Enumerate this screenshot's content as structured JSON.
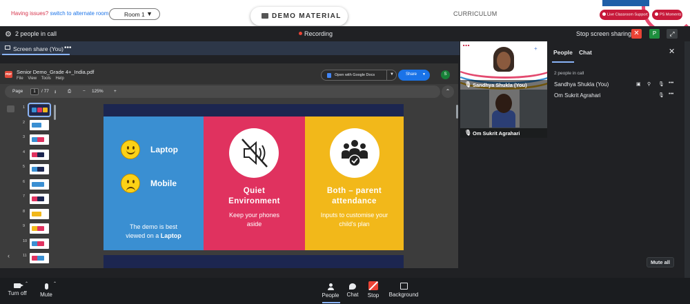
{
  "topbar": {
    "issues_text": "Having issues?",
    "alt_room_link": "switch to alternate room",
    "room_select": "Room 1",
    "demo_material": "DEMO MATERIAL",
    "curriculum": "CURRICULUM",
    "live_classroom": "Live Classroom Support",
    "ps_moments": "PS Moments"
  },
  "callbar": {
    "people_count": "2 people in call",
    "recording": "Recording",
    "stop_sharing": "Stop screen sharing",
    "close_symbol": "✕",
    "avatar_letter": "P"
  },
  "share": {
    "label": "Screen share (You)",
    "more": "•••"
  },
  "pdf": {
    "file_name": "Senior Demo_Grade 4+_India.pdf",
    "menu": "File View Tools Help",
    "open_with": "Open with Google Docs",
    "share": "Share",
    "avatar_letter": "S",
    "page_label": "Page",
    "page_current": "1",
    "page_total": "/ 77",
    "zoom": "125%",
    "thumb_numbers": [
      "1",
      "2",
      "3",
      "4",
      "5",
      "6",
      "7",
      "8",
      "9",
      "10",
      "11",
      "12"
    ]
  },
  "slide": {
    "laptop": "Laptop",
    "mobile": "Mobile",
    "demo_note_line1": "The demo is best",
    "demo_note_line2_prefix": "viewed on a ",
    "demo_note_line2_bold": "Laptop",
    "quiet_title_1": "Quiet",
    "quiet_title_2": "Environment",
    "quiet_caption_1": "Keep your phones",
    "quiet_caption_2": "aside",
    "both_title_1": "Both – parent",
    "both_title_2": "attendance",
    "both_caption_1": "Inputs to customise your",
    "both_caption_2": "child's plan",
    "colors": {
      "blue": "#3a8fd2",
      "pink": "#e0325f",
      "yellow": "#f2b81a",
      "navy": "#1c2650"
    }
  },
  "tiles": [
    {
      "name": "Sandhya Shukla (You)"
    },
    {
      "name": "Om Sukrit Agrahari"
    }
  ],
  "side_panel": {
    "tab_people": "People",
    "tab_chat": "Chat",
    "close": "✕",
    "in_call": "2 people in call",
    "participants": [
      {
        "name": "Sandhya Shukla (You)"
      },
      {
        "name": "Om Sukrit Agrahari"
      }
    ],
    "mute_all": "Mute all"
  },
  "bottom": {
    "turn_off": "Turn off",
    "mute": "Mute",
    "people": "People",
    "chat": "Chat",
    "stop": "Stop",
    "background": "Background"
  }
}
